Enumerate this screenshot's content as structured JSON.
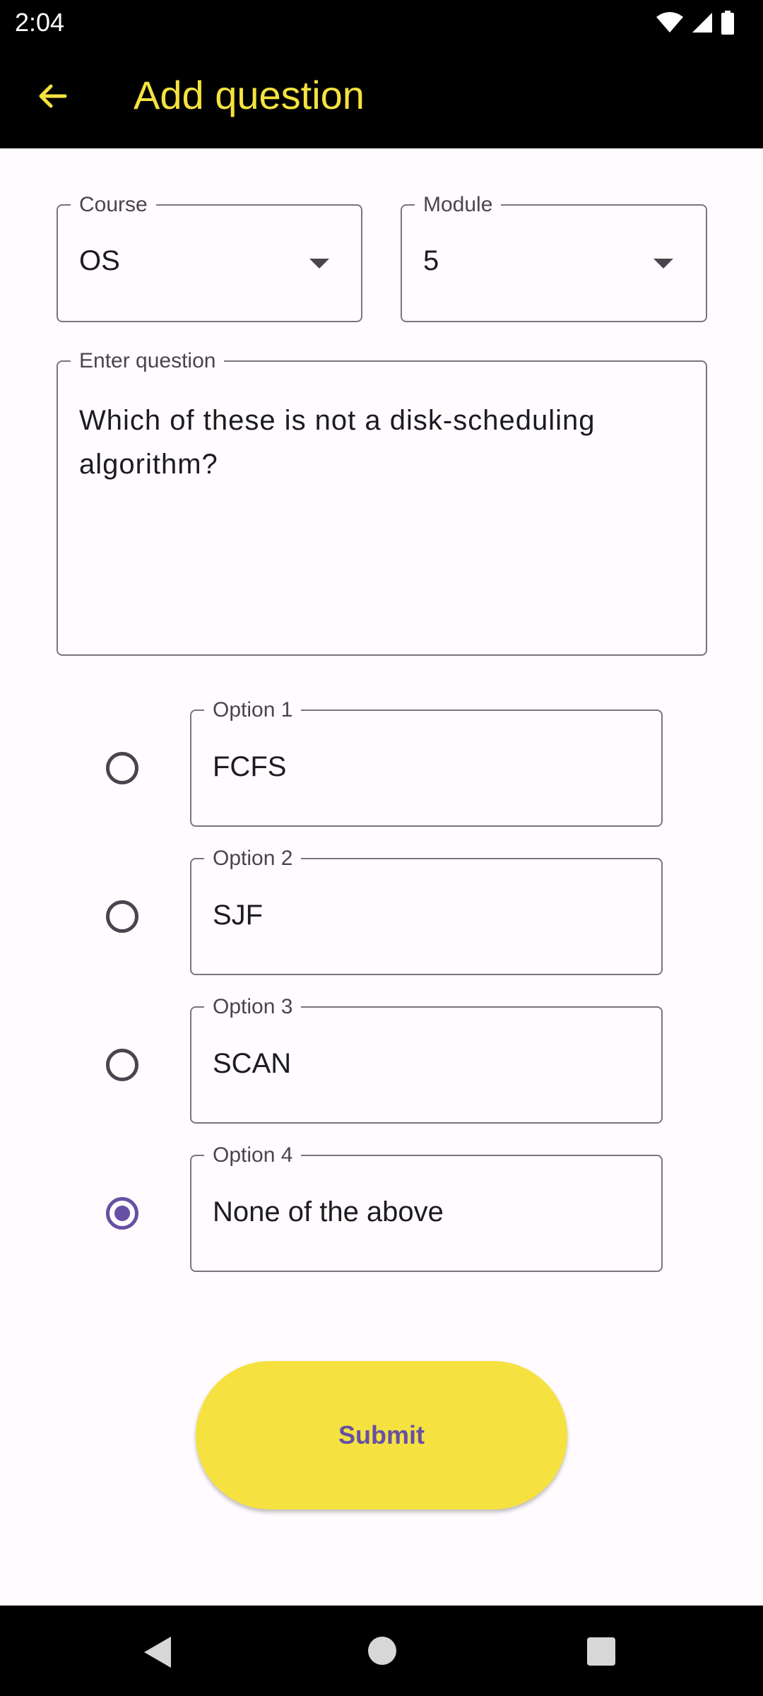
{
  "status_bar": {
    "time": "2:04",
    "icons": [
      "wifi-icon",
      "signal-icon",
      "battery-icon"
    ]
  },
  "app_bar": {
    "title": "Add question",
    "back_icon": "arrow-back-icon",
    "title_color": "#f5e23f"
  },
  "course": {
    "label": "Course",
    "value": "OS"
  },
  "module": {
    "label": "Module",
    "value": "5"
  },
  "question": {
    "label": "Enter question",
    "value": "Which of these is not a disk-scheduling algorithm?"
  },
  "options": [
    {
      "label": "Option 1",
      "value": "FCFS",
      "selected": false
    },
    {
      "label": "Option 2",
      "value": "SJF",
      "selected": false
    },
    {
      "label": "Option 3",
      "value": "SCAN",
      "selected": false
    },
    {
      "label": "Option 4",
      "value": "None of the above",
      "selected": true
    }
  ],
  "submit": {
    "label": "Submit",
    "bg_color": "#f5e240",
    "text_color": "#6750a4"
  },
  "nav_bar": {
    "icons": [
      "nav-back-icon",
      "nav-home-icon",
      "nav-recents-icon"
    ]
  }
}
